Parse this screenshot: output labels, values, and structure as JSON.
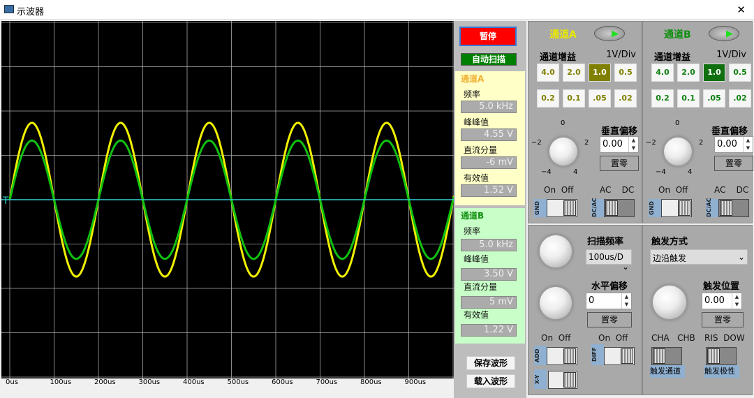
{
  "window": {
    "title": "示波器",
    "close": "✕",
    "icon": "monitor-icon"
  },
  "axis": {
    "x_labels": [
      "0us",
      "100us",
      "200us",
      "300us",
      "400us",
      "500us",
      "600us",
      "700us",
      "800us",
      "900us"
    ],
    "trigger_marker": "T"
  },
  "traces": {
    "a_color": "#f0f000",
    "b_color": "#10c010",
    "trigger_color": "#30d0d0",
    "frequency_khz": 5.0,
    "a_vpp": 4.55,
    "b_vpp": 3.5
  },
  "controls": {
    "pause": "暂停",
    "auto_scan": "自动扫描",
    "save": "保存波形",
    "load": "载入波形"
  },
  "measure_a": {
    "title": "通道A",
    "freq_label": "频率",
    "freq": "5.0 kHz",
    "vpp_label": "峰峰值",
    "vpp": "4.55 V",
    "dc_label": "直流分量",
    "dc": "-6 mV",
    "rms_label": "有效值",
    "rms": "1.52 V"
  },
  "measure_b": {
    "title": "通道B",
    "freq_label": "频率",
    "freq": "5.0 kHz",
    "vpp_label": "峰峰值",
    "vpp": "3.50 V",
    "dc_label": "直流分量",
    "dc": "5 mV",
    "rms_label": "有效值",
    "rms": "1.22 V"
  },
  "channel_a": {
    "title": "通道A",
    "gain_label": "通道增益",
    "div": "1V/Div",
    "gains": [
      "4.0",
      "2.0",
      "1.0",
      "0.5",
      "0.2",
      "0.1",
      ".05",
      ".02"
    ],
    "selected": "1.0",
    "offset_label": "垂直偏移",
    "offset": "0.00",
    "zero": "置零",
    "dial": [
      "0",
      "−2",
      "2",
      "−4",
      "4"
    ],
    "on": "On",
    "off": "Off",
    "ac": "AC",
    "dc": "DC",
    "gnd": "GND",
    "dcac": "DC/AC",
    "accent": "#e8e800",
    "sel_bg": "#808000"
  },
  "channel_b": {
    "title": "通道B",
    "gain_label": "通道增益",
    "div": "1V/Div",
    "gains": [
      "4.0",
      "2.0",
      "1.0",
      "0.5",
      "0.2",
      "0.1",
      ".05",
      ".02"
    ],
    "selected": "1.0",
    "offset_label": "垂直偏移",
    "offset": "0.00",
    "zero": "置零",
    "dial": [
      "0",
      "−2",
      "2",
      "−4",
      "4"
    ],
    "on": "On",
    "off": "Off",
    "ac": "AC",
    "dc": "DC",
    "gnd": "GND",
    "dcac": "DC/AC",
    "accent": "#109010",
    "sel_bg": "#107010"
  },
  "timebase": {
    "scan_label": "扫描频率",
    "scan_value": "100us/D",
    "hoffset_label": "水平偏移",
    "hoffset": "0",
    "zero": "置零",
    "on1": "On",
    "off1": "Off",
    "on2": "On",
    "off2": "Off",
    "add": "ADD",
    "xy": "X-Y",
    "diff": "DIFF"
  },
  "trigger": {
    "mode_label": "触发方式",
    "mode": "边沿触发",
    "pos_label": "触发位置",
    "pos": "0.00",
    "zero": "置零",
    "cha": "CHA",
    "chb": "CHB",
    "ris": "RIS",
    "dow": "DOW",
    "channel_label": "触发通道",
    "polarity_label": "触发极性"
  }
}
